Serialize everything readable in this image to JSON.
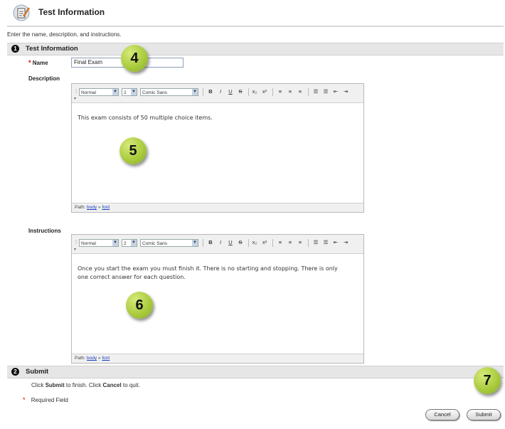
{
  "header": {
    "title": "Test Information",
    "icon": "test-pencil-icon",
    "intro": "Enter the name, description, and instructions."
  },
  "section1": {
    "number": "1",
    "title": "Test Information"
  },
  "name_field": {
    "label": "Name",
    "value": "Final Exam"
  },
  "description": {
    "label": "Description",
    "toolbar": {
      "style": "Normal",
      "size": "2",
      "font": "Comic Sans"
    },
    "content": "This exam consists of 50 multiple choice items.",
    "path_label": "Path:",
    "path_links": [
      "body",
      "font"
    ],
    "path_sep": "»"
  },
  "instructions": {
    "label": "Instructions",
    "toolbar": {
      "style": "Normal",
      "size": "2",
      "font": "Comic Sans"
    },
    "content": "Once you start the exam you must finish it. There is no starting and stopping. There is only one correct answer for each question.",
    "path_label": "Path:",
    "path_links": [
      "body",
      "font"
    ],
    "path_sep": "»"
  },
  "section2": {
    "number": "2",
    "title": "Submit"
  },
  "submit_help": {
    "p1": "Click ",
    "submit": "Submit",
    "p2": " to finish. Click ",
    "cancel": "Cancel",
    "p3": " to quit."
  },
  "required": {
    "marker": "*",
    "text": "Required Field"
  },
  "buttons": {
    "cancel": "Cancel",
    "submit": "Submit"
  },
  "callouts": [
    "4",
    "5",
    "6",
    "7"
  ],
  "colors": {
    "callout": "#a7c93a",
    "section_bar": "#e6e6e6",
    "required": "#dd0000",
    "link": "#1a3fbf"
  }
}
